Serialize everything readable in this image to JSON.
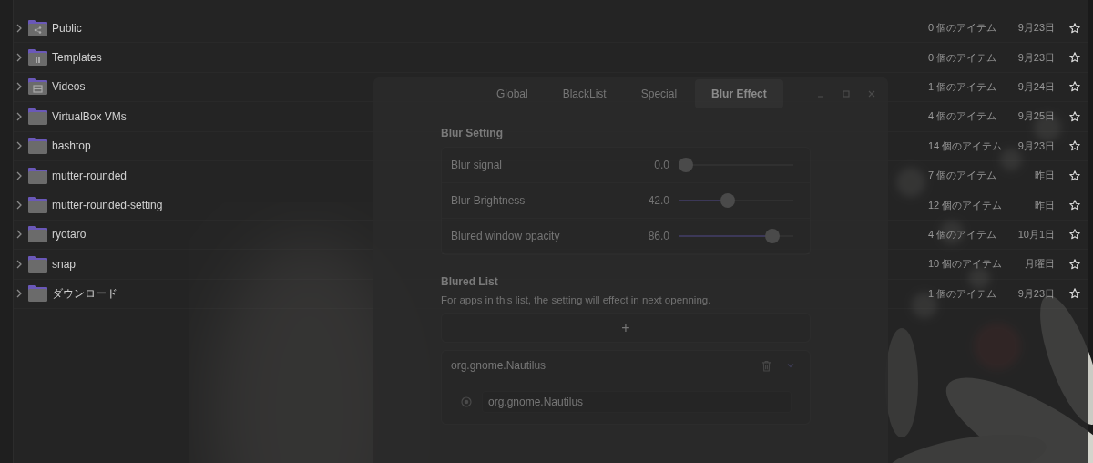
{
  "file_list": {
    "rows": [
      {
        "name": "Public",
        "kind": "public",
        "size": "0 個のアイテム",
        "modified": "9月23日",
        "starred": false
      },
      {
        "name": "Templates",
        "kind": "templates",
        "size": "0 個のアイテム",
        "modified": "9月23日",
        "starred": false
      },
      {
        "name": "Videos",
        "kind": "videos",
        "size": "1 個のアイテム",
        "modified": "9月24日",
        "starred": false
      },
      {
        "name": "VirtualBox VMs",
        "kind": "folder",
        "size": "4 個のアイテム",
        "modified": "9月25日",
        "starred": false
      },
      {
        "name": "bashtop",
        "kind": "folder",
        "size": "14 個のアイテム",
        "modified": "9月23日",
        "starred": false
      },
      {
        "name": "mutter-rounded",
        "kind": "folder",
        "size": "7 個のアイテム",
        "modified": "昨日",
        "starred": false
      },
      {
        "name": "mutter-rounded-setting",
        "kind": "folder",
        "size": "12 個のアイテム",
        "modified": "昨日",
        "starred": false
      },
      {
        "name": "ryotaro",
        "kind": "folder",
        "size": "4 個のアイテム",
        "modified": "10月1日",
        "starred": false
      },
      {
        "name": "snap",
        "kind": "folder",
        "size": "10 個のアイテム",
        "modified": "月曜日",
        "starred": false
      },
      {
        "name": "ダウンロード",
        "kind": "folder",
        "size": "1 個のアイテム",
        "modified": "9月23日",
        "starred": false
      }
    ]
  },
  "settings_window": {
    "tabs": [
      {
        "label": "Global",
        "selected": false
      },
      {
        "label": "BlackList",
        "selected": false
      },
      {
        "label": "Special",
        "selected": false
      },
      {
        "label": "Blur Effect",
        "selected": true
      }
    ],
    "blur_setting": {
      "title": "Blur Setting",
      "rows": [
        {
          "label": "Blur signal",
          "reading": "0.0",
          "level": 0
        },
        {
          "label": "Blur Brightness",
          "reading": "42.0",
          "level": 0.42
        },
        {
          "label": "Blured window opacity",
          "reading": "86.0",
          "level": 0.86
        }
      ]
    },
    "blured_list": {
      "title": "Blured List",
      "description": "For apps in this list, the setting will effect in next openning.",
      "add_button": "+",
      "items": [
        {
          "name": "org.gnome.Nautilus",
          "expanded": true,
          "entries": [
            {
              "value": "org.gnome.Nautilus",
              "selected": true
            }
          ]
        }
      ]
    }
  }
}
